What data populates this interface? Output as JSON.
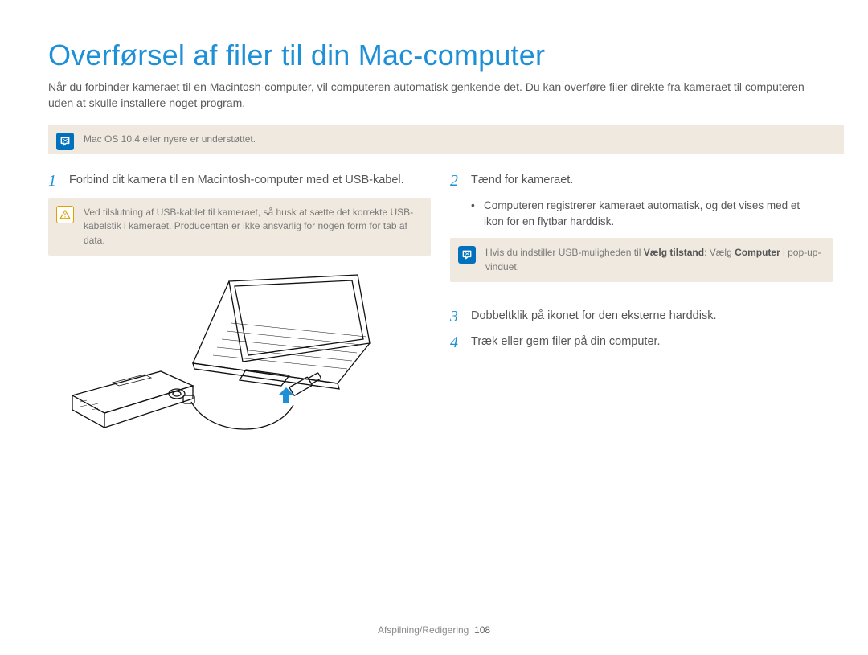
{
  "title": "Overførsel af filer til din Mac-computer",
  "intro": "Når du forbinder kameraet til en Macintosh-computer, vil computeren automatisk genkende det. Du kan overføre filer direkte fra kameraet til computeren uden at skulle installere noget program.",
  "note_top": "Mac OS 10.4 eller nyere er understøttet.",
  "left": {
    "step1_num": "1",
    "step1_text": "Forbind dit kamera til en Macintosh-computer med et USB-kabel.",
    "warn_text": "Ved tilslutning af USB-kablet til kameraet, så husk at sætte det korrekte USB-kabelstik i kameraet. Producenten er ikke ansvarlig for nogen form for tab af data."
  },
  "right": {
    "step2_num": "2",
    "step2_text": "Tænd for kameraet.",
    "step2_bullet": "Computeren registrerer kameraet automatisk, og det vises med et ikon for en flytbar harddisk.",
    "note2_prefix": "Hvis du indstiller USB-muligheden til ",
    "note2_bold1": "Vælg tilstand",
    "note2_mid": ": Vælg ",
    "note2_bold2": "Computer",
    "note2_suffix": " i pop-up-vinduet.",
    "step3_num": "3",
    "step3_text": "Dobbeltklik på ikonet for den eksterne harddisk.",
    "step4_num": "4",
    "step4_text": "Træk eller gem filer på din computer."
  },
  "footer_section": "Afspilning/Redigering",
  "footer_page": "108"
}
